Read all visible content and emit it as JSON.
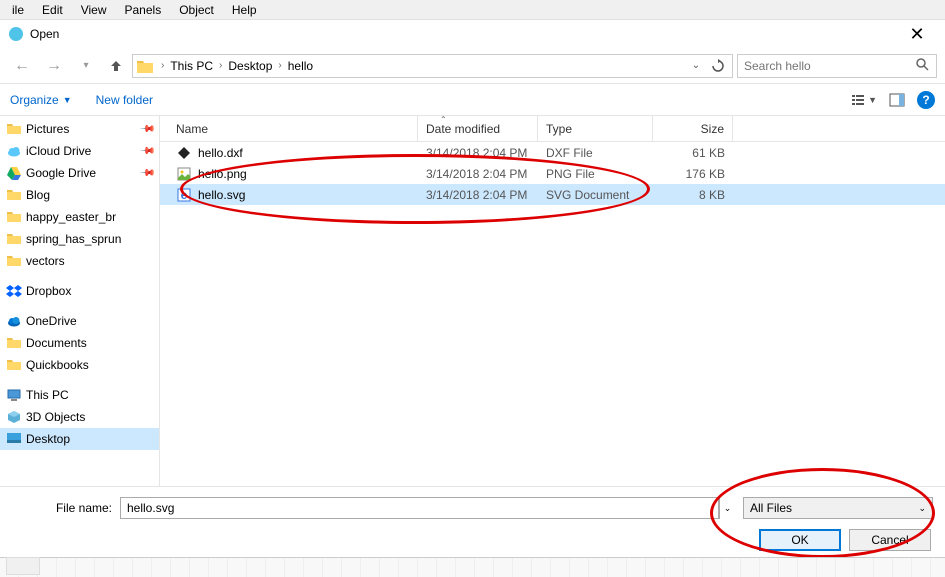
{
  "menubar": [
    "ile",
    "Edit",
    "View",
    "Panels",
    "Object",
    "Help"
  ],
  "dialog": {
    "title": "Open"
  },
  "breadcrumb": [
    "This PC",
    "Desktop",
    "hello"
  ],
  "search": {
    "placeholder": "Search hello"
  },
  "toolbar": {
    "organize": "Organize",
    "newfolder": "New folder"
  },
  "sidebar": [
    {
      "label": "Pictures",
      "icon": "folder",
      "pinned": true
    },
    {
      "label": "iCloud Drive",
      "icon": "icloud",
      "pinned": true
    },
    {
      "label": "Google Drive",
      "icon": "gdrive",
      "pinned": true
    },
    {
      "label": "Blog",
      "icon": "folder"
    },
    {
      "label": "happy_easter_br",
      "icon": "folder"
    },
    {
      "label": "spring_has_sprun",
      "icon": "folder"
    },
    {
      "label": "vectors",
      "icon": "folder"
    },
    {
      "label": "Dropbox",
      "icon": "dropbox",
      "group": true
    },
    {
      "label": "OneDrive",
      "icon": "onedrive",
      "group": true
    },
    {
      "label": "Documents",
      "icon": "folder"
    },
    {
      "label": "Quickbooks",
      "icon": "folder"
    },
    {
      "label": "This PC",
      "icon": "thispc",
      "group": true
    },
    {
      "label": "3D Objects",
      "icon": "3d"
    },
    {
      "label": "Desktop",
      "icon": "desktop",
      "selected": true
    }
  ],
  "columns": {
    "name": "Name",
    "date": "Date modified",
    "type": "Type",
    "size": "Size"
  },
  "files": [
    {
      "name": "hello.dxf",
      "date": "3/14/2018 2:04 PM",
      "type": "DXF File",
      "size": "61 KB",
      "icon": "dxf"
    },
    {
      "name": "hello.png",
      "date": "3/14/2018 2:04 PM",
      "type": "PNG File",
      "size": "176 KB",
      "icon": "png"
    },
    {
      "name": "hello.svg",
      "date": "3/14/2018 2:04 PM",
      "type": "SVG Document",
      "size": "8 KB",
      "icon": "svg",
      "selected": true
    }
  ],
  "bottom": {
    "filename_label": "File name:",
    "filename_value": "hello.svg",
    "filter": "All Files",
    "ok": "OK",
    "cancel": "Cancel"
  }
}
